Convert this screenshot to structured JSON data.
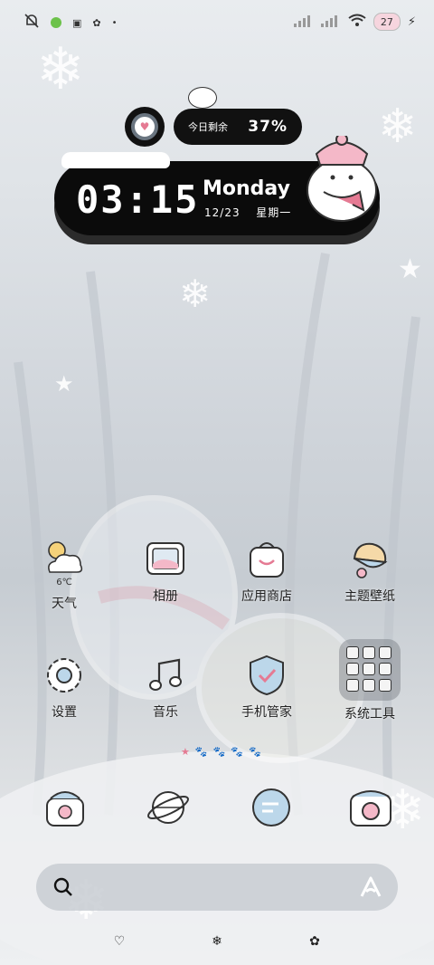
{
  "status_bar": {
    "battery_level": "27"
  },
  "widgets": {
    "remaining": {
      "label": "今日剩余",
      "value": "37%"
    },
    "clock": {
      "time": "03:15",
      "day": "Monday",
      "date": "12/23",
      "weekday": "星期一"
    }
  },
  "apps": [
    {
      "label": "天气",
      "icon": "weather-icon",
      "temp": "6℃"
    },
    {
      "label": "相册",
      "icon": "gallery-icon"
    },
    {
      "label": "应用商店",
      "icon": "app-store-icon"
    },
    {
      "label": "主题壁纸",
      "icon": "themes-icon"
    },
    {
      "label": "设置",
      "icon": "settings-icon"
    },
    {
      "label": "音乐",
      "icon": "music-icon"
    },
    {
      "label": "手机管家",
      "icon": "security-icon"
    },
    {
      "label": "系统工具",
      "icon": "folder-icon"
    }
  ],
  "dock": [
    {
      "icon": "phone-icon"
    },
    {
      "icon": "browser-icon"
    },
    {
      "icon": "messages-icon"
    },
    {
      "icon": "camera-icon"
    }
  ],
  "colors": {
    "accent_pink": "#e57a93",
    "widget_black": "#0b0b0b"
  }
}
